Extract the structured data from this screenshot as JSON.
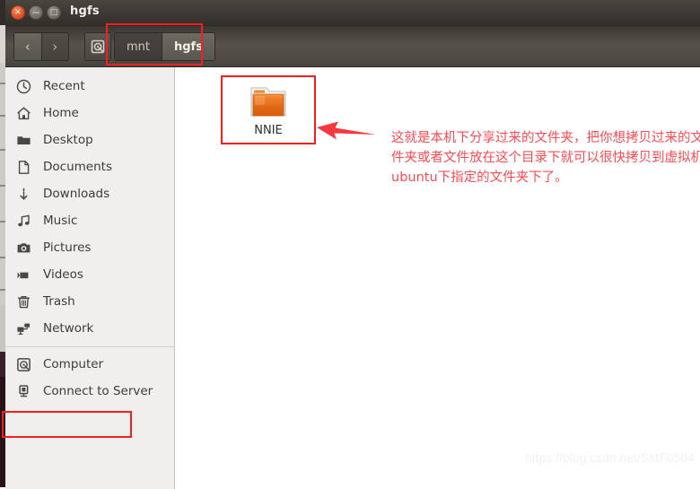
{
  "window": {
    "title": "hgfs",
    "controls": [
      {
        "name": "close",
        "glyph": "×"
      },
      {
        "name": "minimize",
        "glyph": "−"
      },
      {
        "name": "maximize",
        "glyph": "□"
      }
    ]
  },
  "toolbar": {
    "back_glyph": "‹",
    "forward_glyph": "›",
    "location_icon": "computer-disk-icon",
    "breadcrumbs": [
      {
        "label": "mnt",
        "active": false
      },
      {
        "label": "hgfs",
        "active": true
      }
    ]
  },
  "sidebar": {
    "items": [
      {
        "label": "Recent",
        "icon": "clock-icon"
      },
      {
        "label": "Home",
        "icon": "home-icon"
      },
      {
        "label": "Desktop",
        "icon": "folder-icon"
      },
      {
        "label": "Documents",
        "icon": "document-icon"
      },
      {
        "label": "Downloads",
        "icon": "download-arrow-icon"
      },
      {
        "label": "Music",
        "icon": "music-note-icon"
      },
      {
        "label": "Pictures",
        "icon": "camera-icon"
      },
      {
        "label": "Videos",
        "icon": "video-camera-icon"
      },
      {
        "label": "Trash",
        "icon": "trash-icon"
      },
      {
        "label": "Network",
        "icon": "network-icon"
      }
    ],
    "items_after_separator": [
      {
        "label": "Computer",
        "icon": "computer-disk-icon",
        "highlighted": true
      },
      {
        "label": "Connect to Server",
        "icon": "server-icon"
      }
    ]
  },
  "content": {
    "files": [
      {
        "name": "NNIE",
        "icon": "folder-icon",
        "selected": true
      }
    ]
  },
  "annotation": {
    "arrow": "left-arrow",
    "text": "这就是本机下分享过来的文件夹，把你想拷贝过来的文件夹或者文件放在这个目录下就可以很快拷贝到虚拟机ubuntu下指定的文件夹下了。"
  },
  "watermark": {
    "text": "https://blog.csdn.net/SMF0504"
  },
  "colors": {
    "annotation_red": "#fb4b52",
    "highlight_red": "#f02020",
    "folder_orange": "#e8701a",
    "titlebar": "#3b3835",
    "sidebar_bg": "#f1efed"
  }
}
